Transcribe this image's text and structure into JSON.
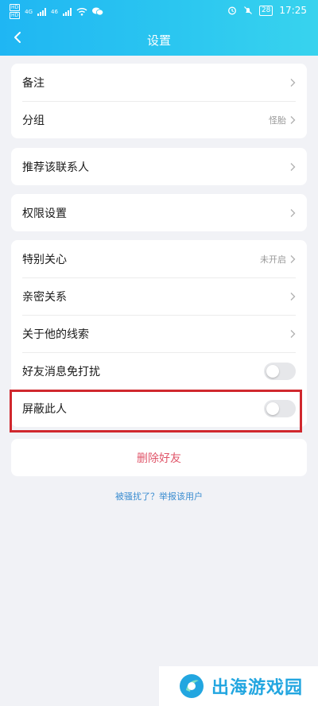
{
  "status_bar": {
    "hd1": "HD",
    "hd2": "HD",
    "net_4g": "4G",
    "net_46": "46",
    "battery": "28",
    "time": "17:25"
  },
  "header": {
    "title": "设置"
  },
  "groups": [
    {
      "rows": [
        {
          "label": "备注",
          "value": ""
        },
        {
          "label": "分组",
          "value": "怪胎"
        }
      ]
    },
    {
      "rows": [
        {
          "label": "推荐该联系人",
          "value": ""
        }
      ]
    },
    {
      "rows": [
        {
          "label": "权限设置",
          "value": ""
        }
      ]
    },
    {
      "rows": [
        {
          "label": "特别关心",
          "value": "未开启"
        },
        {
          "label": "亲密关系",
          "value": ""
        },
        {
          "label": "关于他的线索",
          "value": ""
        },
        {
          "label": "好友消息免打扰",
          "toggle": false
        },
        {
          "label": "屏蔽此人",
          "toggle": false
        }
      ]
    }
  ],
  "delete_label": "删除好友",
  "report_link": "被骚扰了？举报该用户",
  "watermark": "出海游戏园",
  "colors": {
    "header_start": "#1fb6f3",
    "header_end": "#38d3ee",
    "highlight": "#d0282e",
    "delete": "#e0566a",
    "link": "#3a8cd0"
  }
}
